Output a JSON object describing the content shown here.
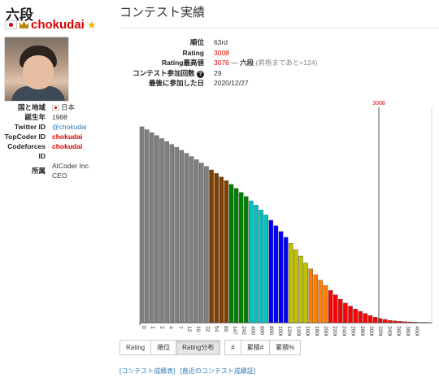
{
  "profile": {
    "rank_title": "六段",
    "username": "chokudai",
    "info": [
      {
        "label": "国と地域",
        "value": "日本"
      },
      {
        "label": "誕生年",
        "value": "1988"
      },
      {
        "label": "Twitter ID",
        "value": "@chokudai"
      },
      {
        "label": "TopCoder ID",
        "value": "chokudai"
      },
      {
        "label": "Codeforces ID",
        "value": "chokudai"
      },
      {
        "label": "所属",
        "value": "AtCoder Inc. CEO"
      }
    ]
  },
  "main": {
    "title": "コンテスト実績",
    "stats": [
      {
        "label": "順位",
        "value": "63rd"
      },
      {
        "label": "Rating",
        "value": "3008"
      },
      {
        "label": "Rating最高値",
        "value": "3076",
        "rank": "六段",
        "note": "(昇格まであと+124)"
      },
      {
        "label": "コンテスト参加回数",
        "value": "29"
      },
      {
        "label": "最後に参加した日",
        "value": "2020/12/27"
      }
    ]
  },
  "chart_data": {
    "type": "bar",
    "title": "",
    "marker": {
      "label": "3008",
      "value": 3008
    },
    "x_ticks_left": [
      "0",
      "1",
      "2",
      "4",
      "7",
      "12",
      "19",
      "32",
      "54",
      "89",
      "147",
      "242",
      "400"
    ],
    "x_ticks_right": [
      "400",
      "600",
      "800",
      "1000",
      "1200",
      "1400",
      "1600",
      "1800",
      "2000",
      "2200",
      "2400",
      "2600",
      "2800",
      "3000",
      "3200",
      "3400",
      "3600",
      "3800",
      "4000"
    ],
    "bin_width": 100,
    "values": [
      1.0,
      0.985,
      0.97,
      0.955,
      0.94,
      0.925,
      0.91,
      0.895,
      0.88,
      0.864,
      0.848,
      0.832,
      0.815,
      0.798,
      0.78,
      0.762,
      0.744,
      0.725,
      0.706,
      0.686,
      0.665,
      0.644,
      0.622,
      0.6,
      0.575,
      0.55,
      0.523,
      0.495,
      0.466,
      0.436,
      0.405,
      0.373,
      0.34,
      0.305,
      0.275,
      0.245,
      0.217,
      0.19,
      0.165,
      0.142,
      0.12,
      0.1,
      0.085,
      0.07,
      0.058,
      0.047,
      0.037,
      0.028,
      0.022,
      0.017,
      0.012,
      0.009,
      0.007,
      0.005,
      0.004,
      0.003,
      0.002,
      0.002
    ],
    "colors": {
      "grey": "#808080",
      "brown": "#804000",
      "green": "#008000",
      "cyan": "#00c0c0",
      "blue": "#0000ff",
      "yellow": "#c0c000",
      "orange": "#ff8000",
      "red": "#ff0000"
    }
  },
  "buttons": {
    "group1": [
      "Rating",
      "順位",
      "Rating分布"
    ],
    "group2": [
      "#",
      "累積#",
      "累積%"
    ],
    "active": "Rating分布"
  },
  "links": [
    "[コンテスト成績表]",
    "[直近のコンテスト成績証]"
  ]
}
